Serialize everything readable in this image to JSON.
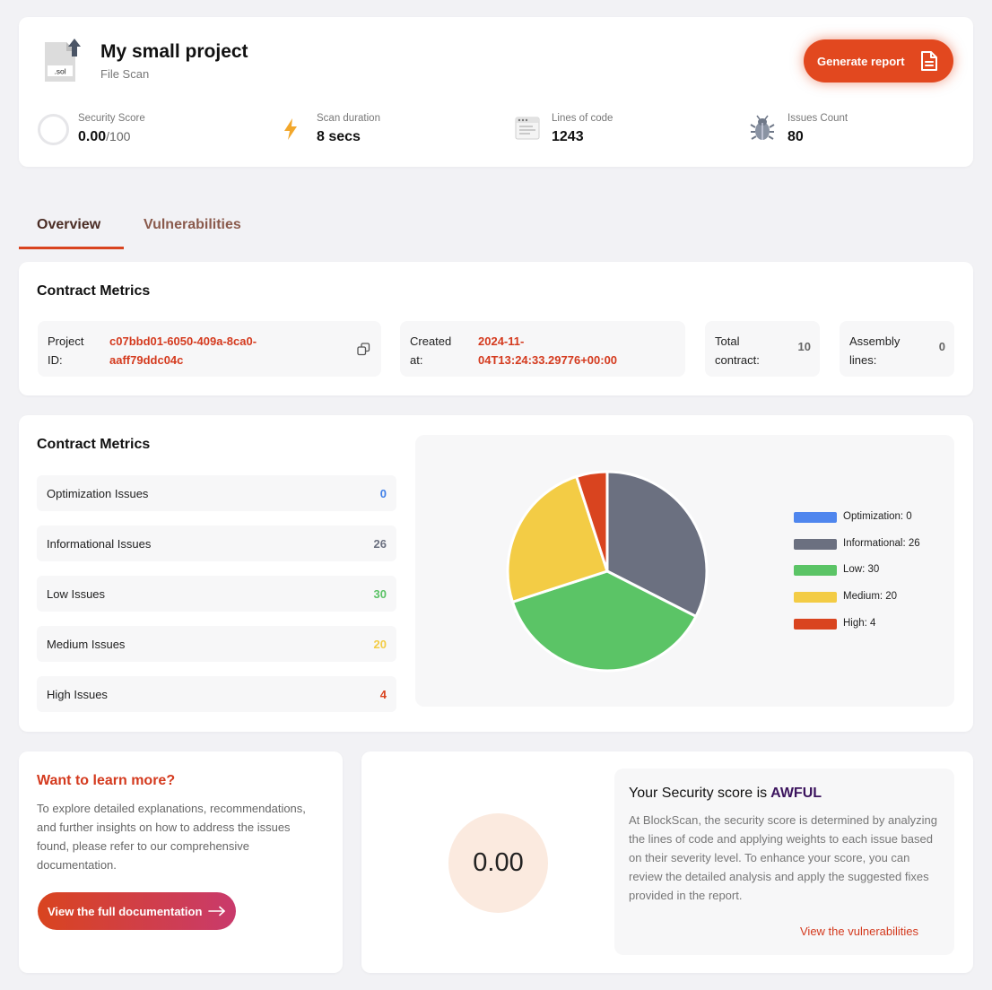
{
  "header": {
    "file_ext": ".sol",
    "title": "My small project",
    "subtitle": "File Scan",
    "generate_label": "Generate report",
    "stats": {
      "score_label": "Security Score",
      "score_value": "0.00",
      "score_max": "/100",
      "duration_label": "Scan duration",
      "duration_value": "8 secs",
      "lines_label": "Lines of code",
      "lines_value": "1243",
      "issues_label": "Issues Count",
      "issues_value": "80"
    }
  },
  "tabs": {
    "overview": "Overview",
    "vulnerabilities": "Vulnerabilities"
  },
  "contract_metrics": {
    "title": "Contract Metrics",
    "project_id_label_1": "Project",
    "project_id_label_2": "ID:",
    "project_id_1": "c07bbd01-6050-409a-8ca0-",
    "project_id_2": "aaff79ddc04c",
    "created_label_1": "Created",
    "created_label_2": "at:",
    "created_1": "2024-11-",
    "created_2": "04T13:24:33.29776+00:00",
    "total_label_1": "Total",
    "total_label_2": "contract:",
    "total_value": "10",
    "assembly_label_1": "Assembly",
    "assembly_label_2": "lines:",
    "assembly_value": "0"
  },
  "issues": {
    "title": "Contract Metrics",
    "rows": [
      {
        "label": "Optimization Issues",
        "value": "0",
        "color": "#3f7fe8"
      },
      {
        "label": "Informational Issues",
        "value": "26",
        "color": "#6b7080"
      },
      {
        "label": "Low Issues",
        "value": "30",
        "color": "#5bc266"
      },
      {
        "label": "Medium Issues",
        "value": "20",
        "color": "#f3cc45"
      },
      {
        "label": "High Issues",
        "value": "4",
        "color": "#d9441f"
      }
    ]
  },
  "chart_data": {
    "type": "pie",
    "categories": [
      "Optimization",
      "Informational",
      "Low",
      "Medium",
      "High"
    ],
    "values": [
      0,
      26,
      30,
      20,
      4
    ],
    "colors": [
      "#4f86ee",
      "#6b7080",
      "#5bc466",
      "#f3cc45",
      "#d9441f"
    ],
    "legend": [
      "Optimization: 0",
      "Informational: 26",
      "Low: 30",
      "Medium: 20",
      "High: 4"
    ],
    "legend_position": "right"
  },
  "learn": {
    "title": "Want to learn more?",
    "text": "To explore detailed explanations, recommendations, and further insights on how to address the issues found, please refer to our comprehensive documentation.",
    "button_label": "View the full documentation"
  },
  "score": {
    "value": "0.00",
    "heading": "Your Security score is",
    "rating": "AWFUL",
    "description": "At BlockScan, the security score is determined by analyzing the lines of code and applying weights to each issue based on their severity level. To enhance your score, you can review the detailed analysis and apply the suggested fixes provided in the report.",
    "link_label": "View the vulnerabilities"
  }
}
